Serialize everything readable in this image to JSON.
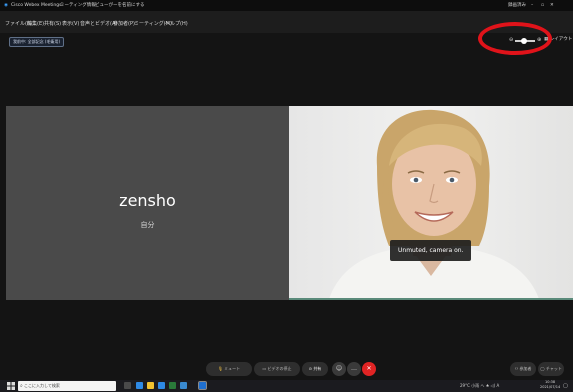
{
  "window": {
    "app_title": "Cisco Webex Meetings",
    "meeting_info": "ミーティング情報",
    "window_hint": "ビューがーを名前にする",
    "right_label": "録画済み"
  },
  "menu": {
    "items": [
      "ファイル(F)",
      "編集(E)",
      "共有(S)",
      "表示(V)",
      "音声とビデオ(A)",
      "参加者(P)",
      "ミーティング(M)",
      "ヘルプ(H)"
    ]
  },
  "recording_chip": "我前中: 全部記念 (毛衛用)",
  "zoom_controls": {
    "layout_label": "レイアウト"
  },
  "participants": {
    "self_name": "zensho",
    "self_label": "自分"
  },
  "toast": "Unmuted, camera on.",
  "controls": {
    "mute_label": "ミュート",
    "video_label": "ビデオの停止",
    "share_label": "共有",
    "more_icon": "more-icon",
    "participants_label": "参加者",
    "chat_label": "チャット"
  },
  "taskbar": {
    "search_placeholder": "ここに入力して検索",
    "tray_text": "29°C 小雨 ヘ ♠ ◁) A",
    "time": "10:38",
    "date": "2021/07/14"
  },
  "colors": {
    "highlight": "#e0131a",
    "end_button": "#e02424",
    "accent": "#1a73e8"
  }
}
